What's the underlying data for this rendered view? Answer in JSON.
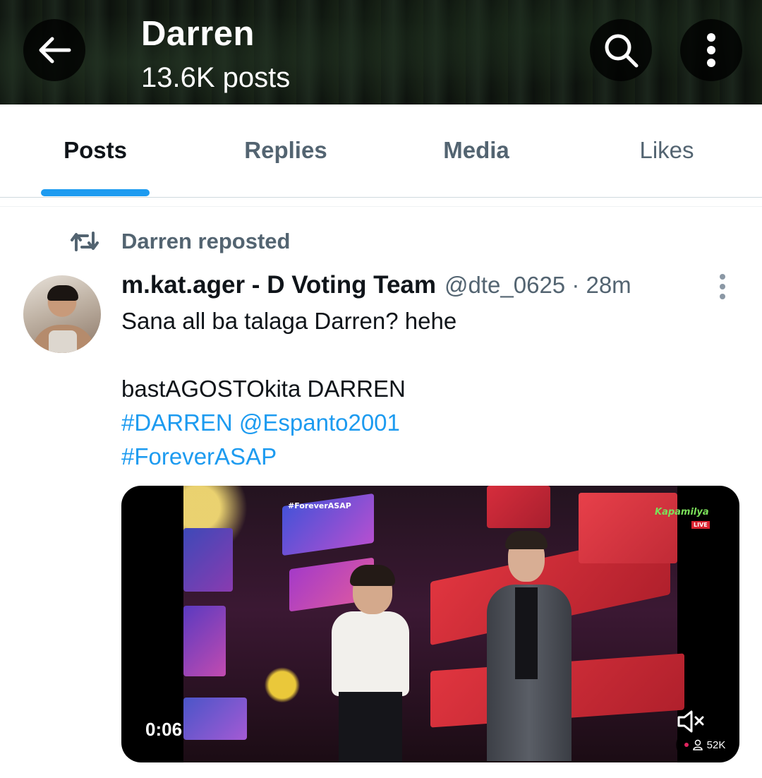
{
  "header": {
    "title": "Darren",
    "post_count": "13.6K posts"
  },
  "tabs": [
    {
      "label": "Posts",
      "active": true
    },
    {
      "label": "Replies",
      "active": false
    },
    {
      "label": "Media",
      "active": false
    },
    {
      "label": "Likes",
      "active": false
    }
  ],
  "post": {
    "repost_label": "Darren reposted",
    "author_name": "m.kat.ager - D Voting Team",
    "author_handle_time": "@dte_0625 · 28m",
    "text_line1": "Sana all ba talaga Darren? hehe",
    "text_line2": "bastAGOSTOkita DARREN",
    "hashtag1": "#DARREN",
    "mention": "@Espanto2001",
    "hashtag2": "#ForeverASAP",
    "video": {
      "overlay_hashtag": "#ForeverASAP",
      "channel_tag": "Kapamilya",
      "live_tag": "LIVE",
      "duration": "0:06",
      "views": "52K"
    }
  },
  "colors": {
    "accent": "#1d9bf0",
    "secondary_text": "#536471",
    "primary_text": "#0f1419"
  },
  "icons": [
    "back-arrow-icon",
    "search-icon",
    "more-vertical-icon",
    "repost-icon",
    "mute-icon",
    "views-person-icon"
  ]
}
